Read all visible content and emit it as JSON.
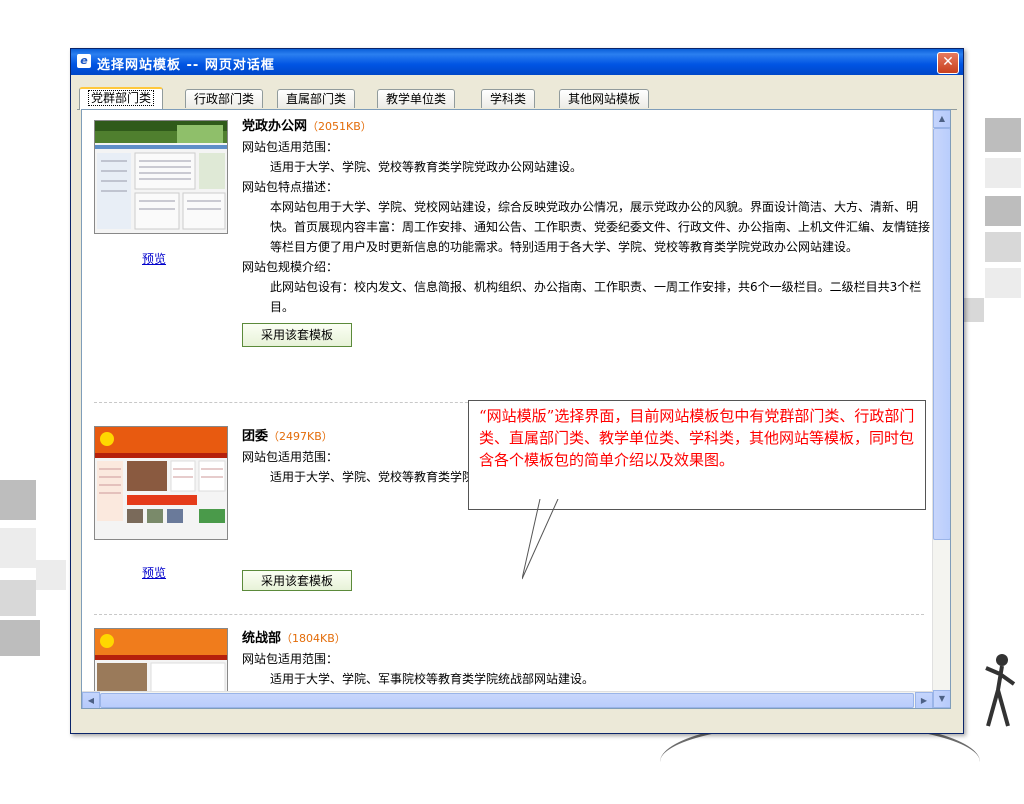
{
  "window": {
    "title": "选择网站模板 -- 网页对话框",
    "close_label": "✕"
  },
  "tabs": [
    {
      "label": "党群部门类",
      "active": true
    },
    {
      "label": "行政部门类"
    },
    {
      "label": "直属部门类"
    },
    {
      "label": "教学单位类"
    },
    {
      "label": "学科类"
    },
    {
      "label": "其他网站模板"
    }
  ],
  "templates": [
    {
      "name": "党政办公网",
      "size": "（2051KB）",
      "preview": "预览",
      "scope_label": "网站包适用范围：",
      "scope": "适用于大学、学院、党校等教育类学院党政办公网站建设。",
      "feature_label": "网站包特点描述：",
      "feature": "本网站包用于大学、学院、党校网站建设，综合反映党政办公情况，展示党政办公的风貌。界面设计简洁、大方、清新、明快。首页展现内容丰富：周工作安排、通知公告、工作职责、党委纪委文件、行政文件、办公指南、上机文件汇编、友情链接等栏目方便了用户及时更新信息的功能需求。特别适用于各大学、学院、党校等教育类学院党政办公网站建设。",
      "scale_label": "网站包规模介绍：",
      "scale": "此网站包设有：校内发文、信息简报、机构组织、办公指南、工作职责、一周工作安排，共6个一级栏目。二级栏目共3个栏目。",
      "use_button": "采用该套模板"
    },
    {
      "name": "团委",
      "size": "（2497KB）",
      "preview": "预览",
      "scope_label": "网站包适用范围：",
      "scope": "适用于大学、学院、党校等教育类学院团委网站建设。",
      "use_button": "采用该套模板"
    },
    {
      "name": "统战部",
      "size": "（1804KB）",
      "scope_label": "网站包适用范围：",
      "scope": "适用于大学、学院、军事院校等教育类学院统战部网站建设。"
    }
  ],
  "callout": {
    "text": "“网站模版”选择界面，目前网站模板包中有党群部门类、行政部门类、直属部门类、教学单位类、学科类，其他网站等模板，同时包含各个模板包的简单介绍以及效果图。"
  },
  "colors": {
    "titlebar": "#0054e3",
    "callout_text": "#ff0000",
    "size_text": "#e36c09",
    "link": "#0000cc"
  }
}
